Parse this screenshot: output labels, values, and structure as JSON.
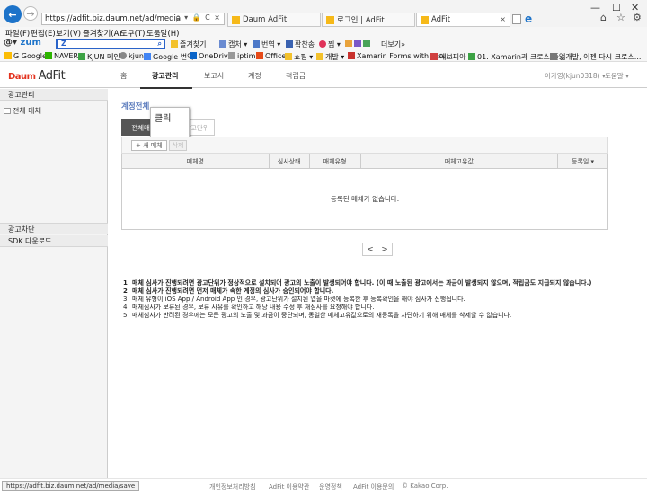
{
  "browser": {
    "address": "https://adfit.biz.daum.net/ad/media",
    "address_tools": "ρ ▾ 🔒 C ×",
    "tabs": [
      {
        "title": "Daum AdFit"
      },
      {
        "title": "로그인 | AdFit"
      },
      {
        "title": "AdFit"
      }
    ],
    "menu": [
      "파일(F)",
      "편집(E)",
      "보기(V)",
      "즐겨찾기(A)",
      "도구(T)",
      "도움말(H)"
    ],
    "toolbar": {
      "logo_prefix": "@▾",
      "logo": "zum",
      "search_value": "Z",
      "items": [
        "즐겨찾기",
        "캡처 ▾",
        "번역 ▾",
        "확찬송",
        "찜 ▾",
        "더보기»"
      ]
    },
    "favorites": [
      "G Google",
      "NAVER",
      "KJUN 메인",
      "kjun",
      "Google 번역",
      "OneDrive",
      "iptime",
      "Office",
      "쇼핑 ▾",
      "개발 ▾",
      "Xamarin Forms with Visu...",
      "에브피아",
      "01. Xamarin과 크로스 플...",
      "앱개발, 이젠 다시 크로스..."
    ],
    "status_url": "https://adfit.biz.daum.net/ad/media/save"
  },
  "site": {
    "logo_daum": "Daum",
    "logo_adfit": "AdFit",
    "nav": [
      "홈",
      "광고관리",
      "보고서",
      "계정",
      "적립금"
    ],
    "user": "이가영(kjun0318) ▾",
    "help": "도움말 ▾"
  },
  "sidebar": {
    "header": "광고관리",
    "item": "전체 매체",
    "block": "광고차단",
    "sdk": "SDK 다운로드"
  },
  "main": {
    "title": "계정전체",
    "tab_media": "전체매체",
    "tab_unit": "전체광고단위",
    "tooltip": "클릭",
    "new_button": "+ 새 매체",
    "delete_button": "삭제",
    "table": {
      "headers": [
        "매체명",
        "심사상태",
        "매체유형",
        "매체고유값",
        "등록일 ▾"
      ],
      "empty": "등록된 매체가 없습니다."
    },
    "pager_prev": "<",
    "pager_next": ">",
    "notes": [
      "매체 심사가 진행되려면 광고단위가 정상적으로 설치되어 광고의 노출이 발생되어야 합니다. (이 때 노출된 광고에서는 과금이 발생되지 않으며, 적립금도 지급되지 않습니다.)",
      "매체 심사가 진행되려면 먼저 매체가 속한 계정의 심사가 승인되어야 합니다.",
      "매체 유형이 iOS App / Android App 인 경우, 광고단위가 설치된 앱을 마켓에 등록한 후 등록확인을 해야 심사가 진행됩니다.",
      "매체심사가 보류된 경우, 보류 사유를 확인하고 해당 내용 수정 후 재심사를 요청해야 합니다.",
      "매체심사가 반려된 경우에는 모든 광고의 노출 및 과금이 중단되며, 동일한 매체고유값으로의 재등록을 차단하기 위해 매체를 삭제할 수 없습니다."
    ]
  },
  "footer": [
    "개인정보처리방침",
    "AdFit 이용약관",
    "운영정책",
    "AdFit 이용문의",
    "© Kakao Corp."
  ]
}
